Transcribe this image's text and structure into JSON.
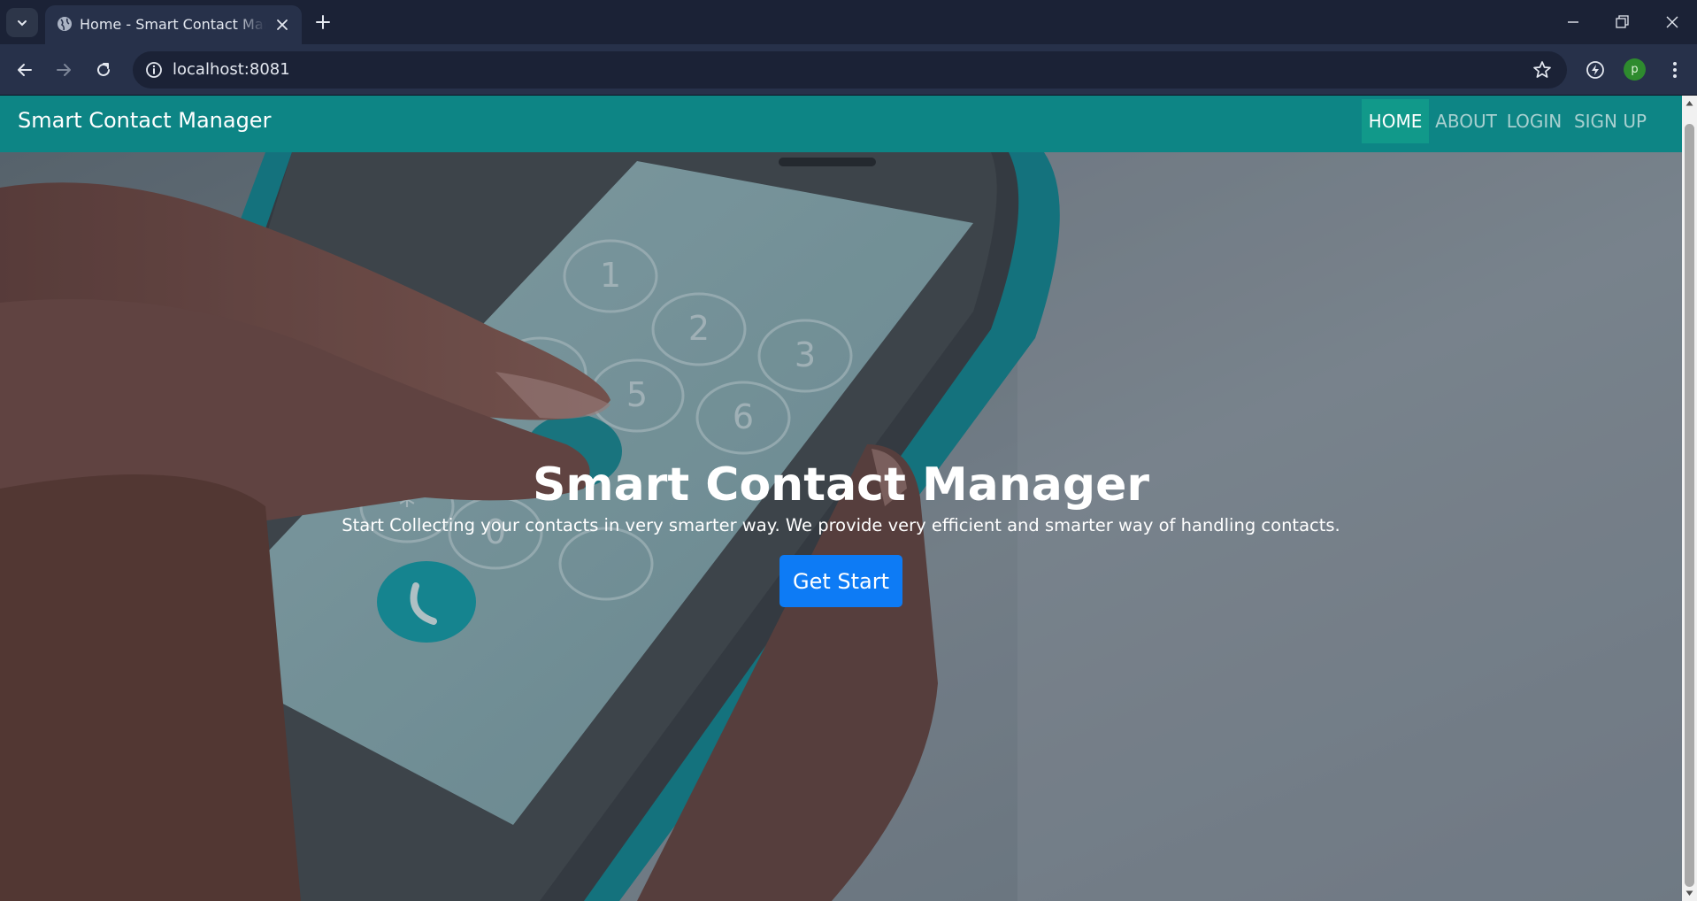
{
  "browser": {
    "tab": {
      "title": "Home - Smart Contact Manager"
    },
    "address_bar": {
      "url": "localhost:8081"
    },
    "profile": {
      "initial": "p"
    }
  },
  "navbar": {
    "brand": "Smart Contact Manager",
    "links": [
      {
        "label": "HOME",
        "active": true
      },
      {
        "label": "ABOUT",
        "active": false
      },
      {
        "label": "LOGIN",
        "active": false
      },
      {
        "label": "SIGN UP",
        "active": false
      }
    ]
  },
  "hero": {
    "title": "Smart Contact Manager",
    "subtitle": "Start Collecting your contacts in very smarter way. We provide very efficient and smarter way of handling contacts.",
    "button_label": "Get Start"
  },
  "phone_keypad": {
    "keys": [
      "1",
      "2",
      "3",
      "4",
      "5",
      "6",
      "*",
      "0"
    ]
  },
  "colors": {
    "navbar": "#0d8585",
    "nav_active": "#11998a",
    "button": "#0d7bf5",
    "browser_frame": "#1b2236"
  },
  "icons": {
    "tab_search": "chevron-down-icon",
    "tab_favicon": "globe-icon",
    "tab_close": "close-icon",
    "new_tab": "plus-icon",
    "back": "arrow-left-icon",
    "forward": "arrow-right-icon",
    "reload": "reload-icon",
    "site_info": "info-icon",
    "bookmark": "star-icon",
    "extension": "extension-icon",
    "menu": "more-vertical-icon"
  }
}
